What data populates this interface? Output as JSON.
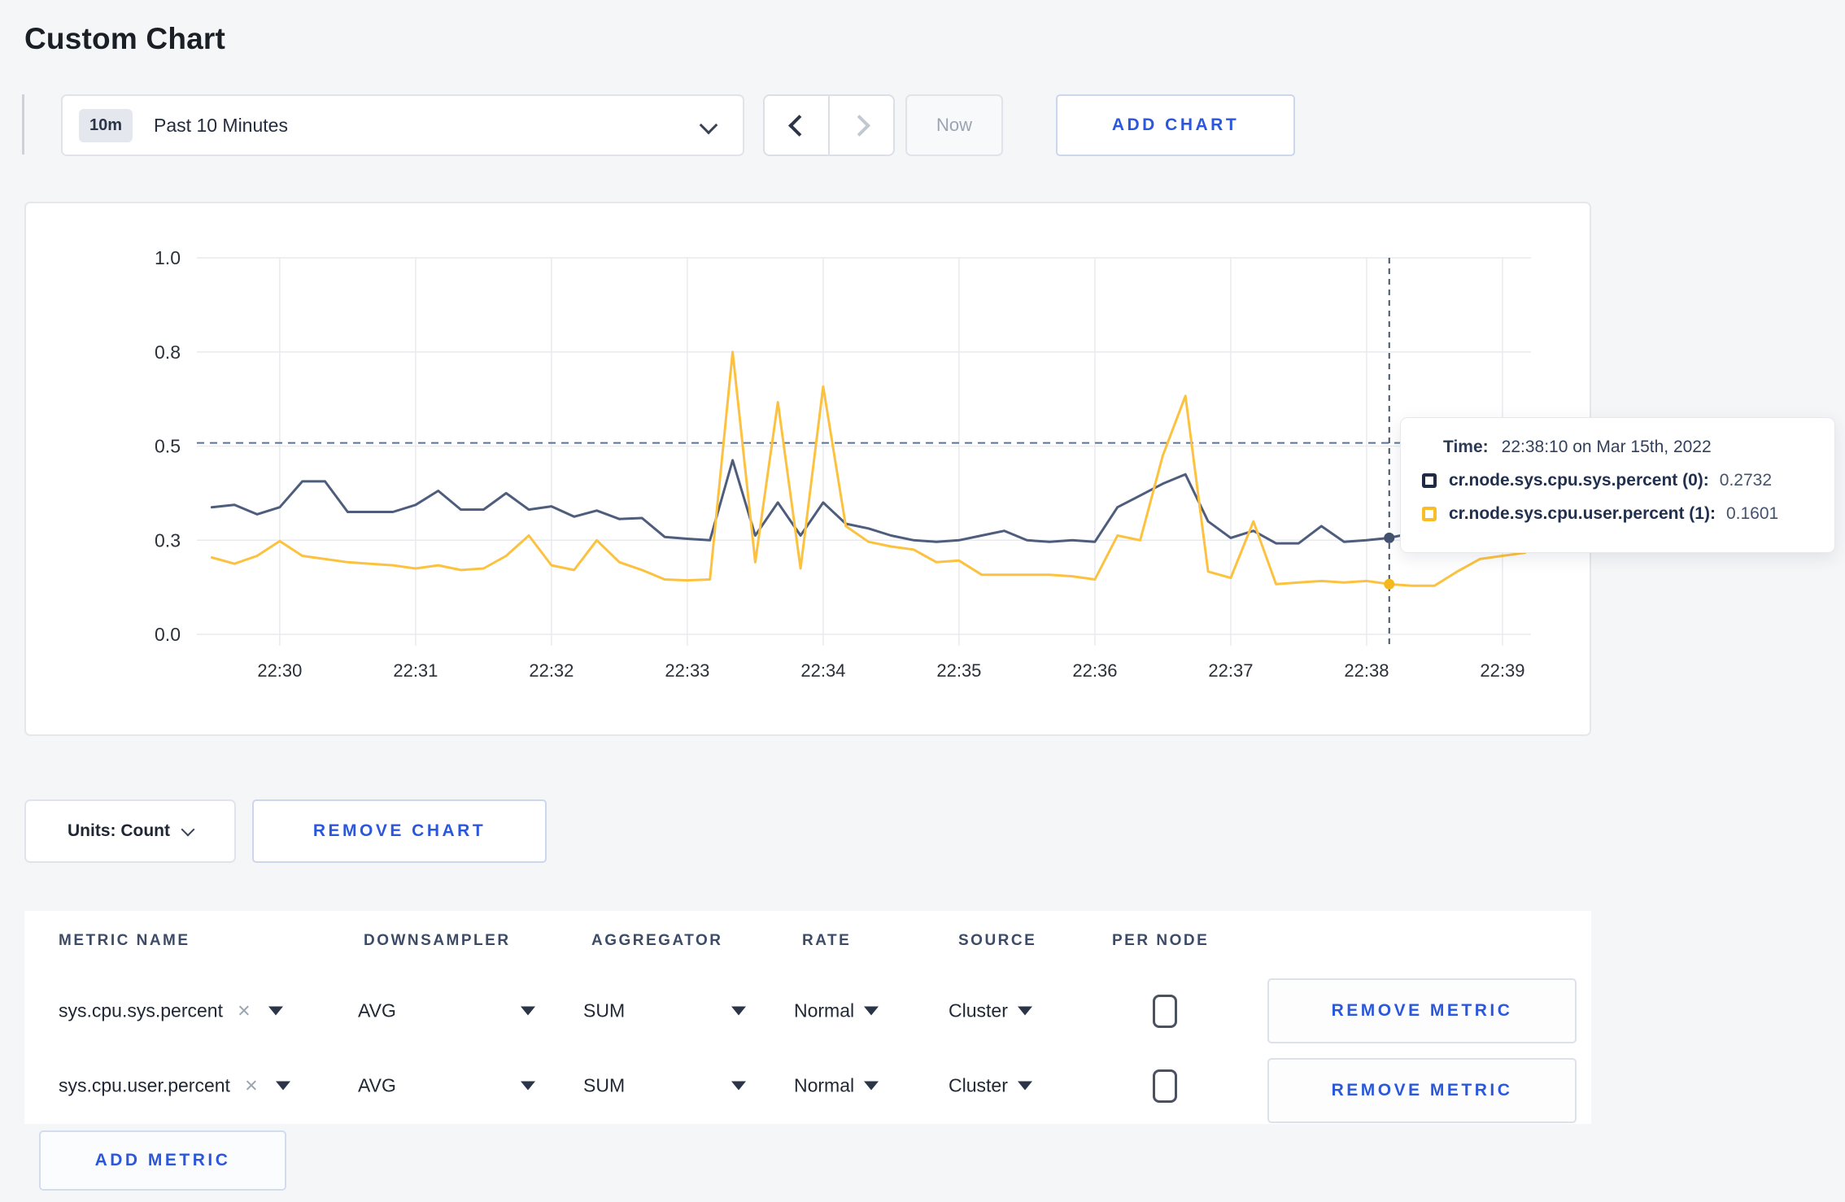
{
  "page": {
    "title": "Custom Chart"
  },
  "toolbar": {
    "time_range": {
      "badge": "10m",
      "label": "Past 10 Minutes"
    },
    "now_label": "Now",
    "add_chart_label": "ADD CHART"
  },
  "tooltip": {
    "time_label": "Time:",
    "time_value": "22:38:10 on Mar 15th, 2022",
    "series": [
      {
        "name": "cr.node.sys.cpu.sys.percent (0):",
        "value": "0.2732",
        "color": "#1f2a44"
      },
      {
        "name": "cr.node.sys.cpu.user.percent (1):",
        "value": "0.1601",
        "color": "#f8bd27"
      }
    ]
  },
  "units_button_label": "Units: Count",
  "remove_chart_label": "REMOVE CHART",
  "metrics_table": {
    "headers": [
      "METRIC NAME",
      "DOWNSAMPLER",
      "AGGREGATOR",
      "RATE",
      "SOURCE",
      "PER NODE"
    ],
    "rows": [
      {
        "metric": "sys.cpu.sys.percent",
        "close": "×",
        "downsampler": "AVG",
        "aggregator": "SUM",
        "rate": "Normal",
        "source": "Cluster",
        "per_node_checked": false,
        "remove_label": "REMOVE METRIC"
      },
      {
        "metric": "sys.cpu.user.percent",
        "close": "×",
        "downsampler": "AVG",
        "aggregator": "SUM",
        "rate": "Normal",
        "source": "Cluster",
        "per_node_checked": false,
        "remove_label": "REMOVE METRIC"
      }
    ],
    "add_metric_label": "ADD METRIC"
  },
  "chart_data": {
    "type": "line",
    "title": "",
    "xlabel": "",
    "ylabel": "",
    "grid": true,
    "x_tick_labels": [
      "22:30",
      "22:31",
      "22:32",
      "22:33",
      "22:34",
      "22:35",
      "22:36",
      "22:37",
      "22:38",
      "22:39"
    ],
    "y_ticks": [
      {
        "value": 1.0,
        "label": "1.0"
      },
      {
        "value": 0.8,
        "label": "0.8"
      },
      {
        "value": 0.5,
        "label": "0.5"
      },
      {
        "value": 0.3,
        "label": "0.3"
      },
      {
        "value": 0.0,
        "label": "0.0"
      }
    ],
    "x_start": "22:29:30",
    "x_interval_seconds": 10,
    "reference_line_y": 0.51,
    "crosshair": {
      "index": 52,
      "time": "22:38:10"
    },
    "series": [
      {
        "name": "cr.node.sys.cpu.sys.percent",
        "color": "#4e5d7c",
        "dot_color": "#43526e",
        "values": [
          0.37,
          0.375,
          0.355,
          0.37,
          0.425,
          0.425,
          0.36,
          0.36,
          0.36,
          0.375,
          0.405,
          0.365,
          0.365,
          0.4,
          0.365,
          0.372,
          0.35,
          0.363,
          0.345,
          0.347,
          0.307,
          0.303,
          0.3,
          0.47,
          0.31,
          0.38,
          0.31,
          0.38,
          0.335,
          0.325,
          0.31,
          0.3,
          0.295,
          0.3,
          0.31,
          0.32,
          0.3,
          0.295,
          0.3,
          0.295,
          0.37,
          0.395,
          0.42,
          0.44,
          0.34,
          0.305,
          0.32,
          0.29,
          0.29,
          0.33,
          0.295,
          0.3,
          0.305,
          0.315,
          0.3,
          0.295,
          0.3,
          0.31,
          0.305
        ]
      },
      {
        "name": "cr.node.sys.cpu.user.percent",
        "color": "#fcc23f",
        "dot_color": "#f5b91e",
        "values": [
          0.245,
          0.225,
          0.25,
          0.297,
          0.25,
          0.24,
          0.23,
          0.225,
          0.22,
          0.21,
          0.22,
          0.205,
          0.21,
          0.25,
          0.31,
          0.22,
          0.205,
          0.3,
          0.23,
          0.205,
          0.175,
          0.172,
          0.175,
          0.8,
          0.23,
          0.64,
          0.21,
          0.69,
          0.33,
          0.295,
          0.28,
          0.27,
          0.23,
          0.235,
          0.19,
          0.19,
          0.19,
          0.19,
          0.185,
          0.175,
          0.31,
          0.3,
          0.48,
          0.66,
          0.2,
          0.18,
          0.34,
          0.16,
          0.165,
          0.17,
          0.165,
          0.17,
          0.1601,
          0.155,
          0.155,
          0.2,
          0.24,
          0.25,
          0.26
        ]
      }
    ]
  }
}
